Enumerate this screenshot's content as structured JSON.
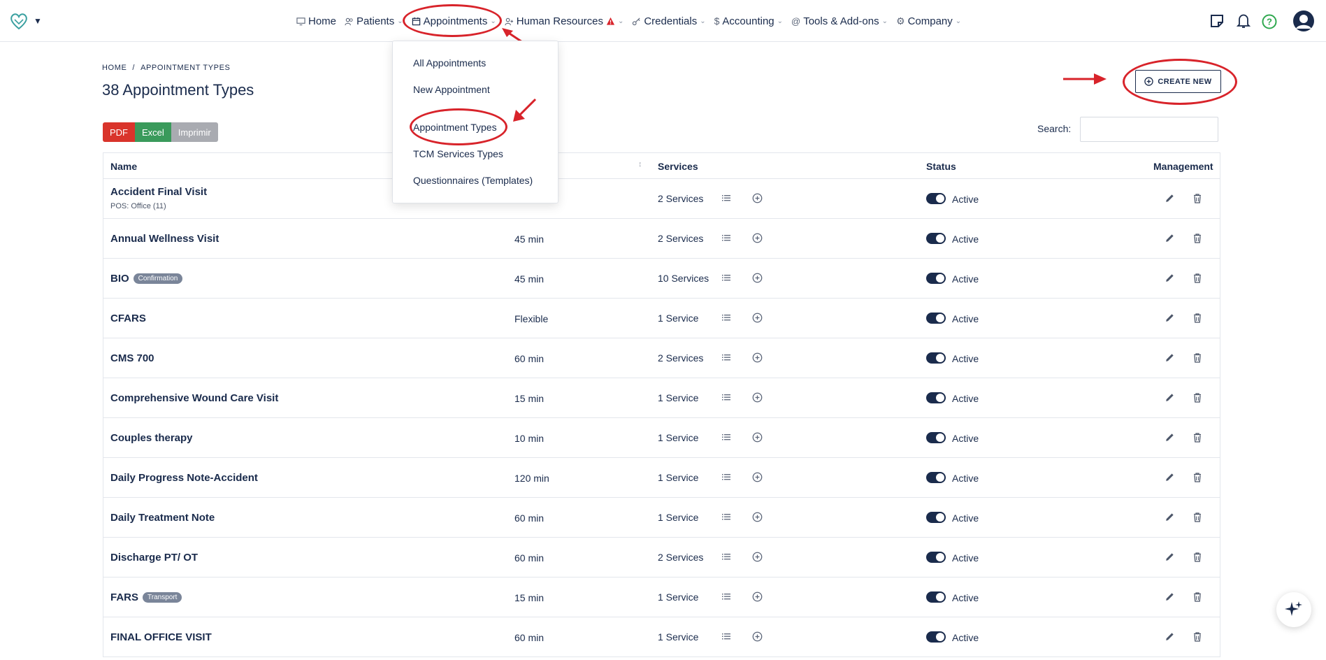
{
  "header": {
    "logo_icon": "heart-hands-logo",
    "nav": [
      {
        "label": "Home",
        "icon": "monitor-icon"
      },
      {
        "label": "Patients",
        "icon": "users-icon"
      },
      {
        "label": "Appointments",
        "icon": "calendar-icon"
      },
      {
        "label": "Human Resources",
        "icon": "user-plus-icon"
      },
      {
        "label": "Credentials",
        "icon": "key-icon"
      },
      {
        "label": "Accounting",
        "icon": "dollar-icon"
      },
      {
        "label": "Tools & Add-ons",
        "icon": "at-icon"
      },
      {
        "label": "Company",
        "icon": "gear-icon"
      }
    ],
    "right_icons": [
      "notes-icon",
      "bell-icon",
      "help-icon",
      "user-avatar-icon"
    ]
  },
  "dropdown": {
    "items": [
      "All Appointments",
      "New Appointment",
      "Appointment Types",
      "TCM Services Types",
      "Questionnaires (Templates)"
    ]
  },
  "breadcrumb": {
    "home": "HOME",
    "separator": "/",
    "current": "APPOINTMENT TYPES"
  },
  "page_title": "38 Appointment Types",
  "create_button": "CREATE NEW",
  "export": {
    "pdf": "PDF",
    "excel": "Excel",
    "print": "Imprimir"
  },
  "search": {
    "label": "Search:",
    "value": ""
  },
  "table": {
    "headers": {
      "name": "Name",
      "services": "Services",
      "status": "Status",
      "management": "Management"
    },
    "rows": [
      {
        "name": "Accident Final Visit",
        "sub": "POS: Office (11)",
        "badge": "",
        "duration": "",
        "services": "2 Services",
        "status": "Active"
      },
      {
        "name": "Annual Wellness Visit",
        "sub": "",
        "badge": "",
        "duration": "45 min",
        "services": "2 Services",
        "status": "Active"
      },
      {
        "name": "BIO",
        "sub": "",
        "badge": "Confirmation",
        "duration": "45 min",
        "services": "10 Services",
        "status": "Active"
      },
      {
        "name": "CFARS",
        "sub": "",
        "badge": "",
        "duration": "Flexible",
        "services": "1 Service",
        "status": "Active"
      },
      {
        "name": "CMS 700",
        "sub": "",
        "badge": "",
        "duration": "60 min",
        "services": "2 Services",
        "status": "Active"
      },
      {
        "name": "Comprehensive Wound Care Visit",
        "sub": "",
        "badge": "",
        "duration": "15 min",
        "services": "1 Service",
        "status": "Active"
      },
      {
        "name": "Couples therapy",
        "sub": "",
        "badge": "",
        "duration": "10 min",
        "services": "1 Service",
        "status": "Active"
      },
      {
        "name": "Daily Progress Note-Accident",
        "sub": "",
        "badge": "",
        "duration": "120 min",
        "services": "1 Service",
        "status": "Active"
      },
      {
        "name": "Daily Treatment Note",
        "sub": "",
        "badge": "",
        "duration": "60 min",
        "services": "1 Service",
        "status": "Active"
      },
      {
        "name": "Discharge PT/ OT",
        "sub": "",
        "badge": "",
        "duration": "60 min",
        "services": "2 Services",
        "status": "Active"
      },
      {
        "name": "FARS",
        "sub": "",
        "badge": "Transport",
        "duration": "15 min",
        "services": "1 Service",
        "status": "Active"
      },
      {
        "name": "FINAL OFFICE VISIT",
        "sub": "",
        "badge": "",
        "duration": "60 min",
        "services": "1 Service",
        "status": "Active"
      }
    ]
  },
  "colors": {
    "primary": "#1a2b4c",
    "annotation": "#d8232a",
    "pdf": "#d9342b",
    "excel": "#3a9a5b",
    "print": "#a9abb1"
  },
  "fab_icon": "sparkle-icon"
}
